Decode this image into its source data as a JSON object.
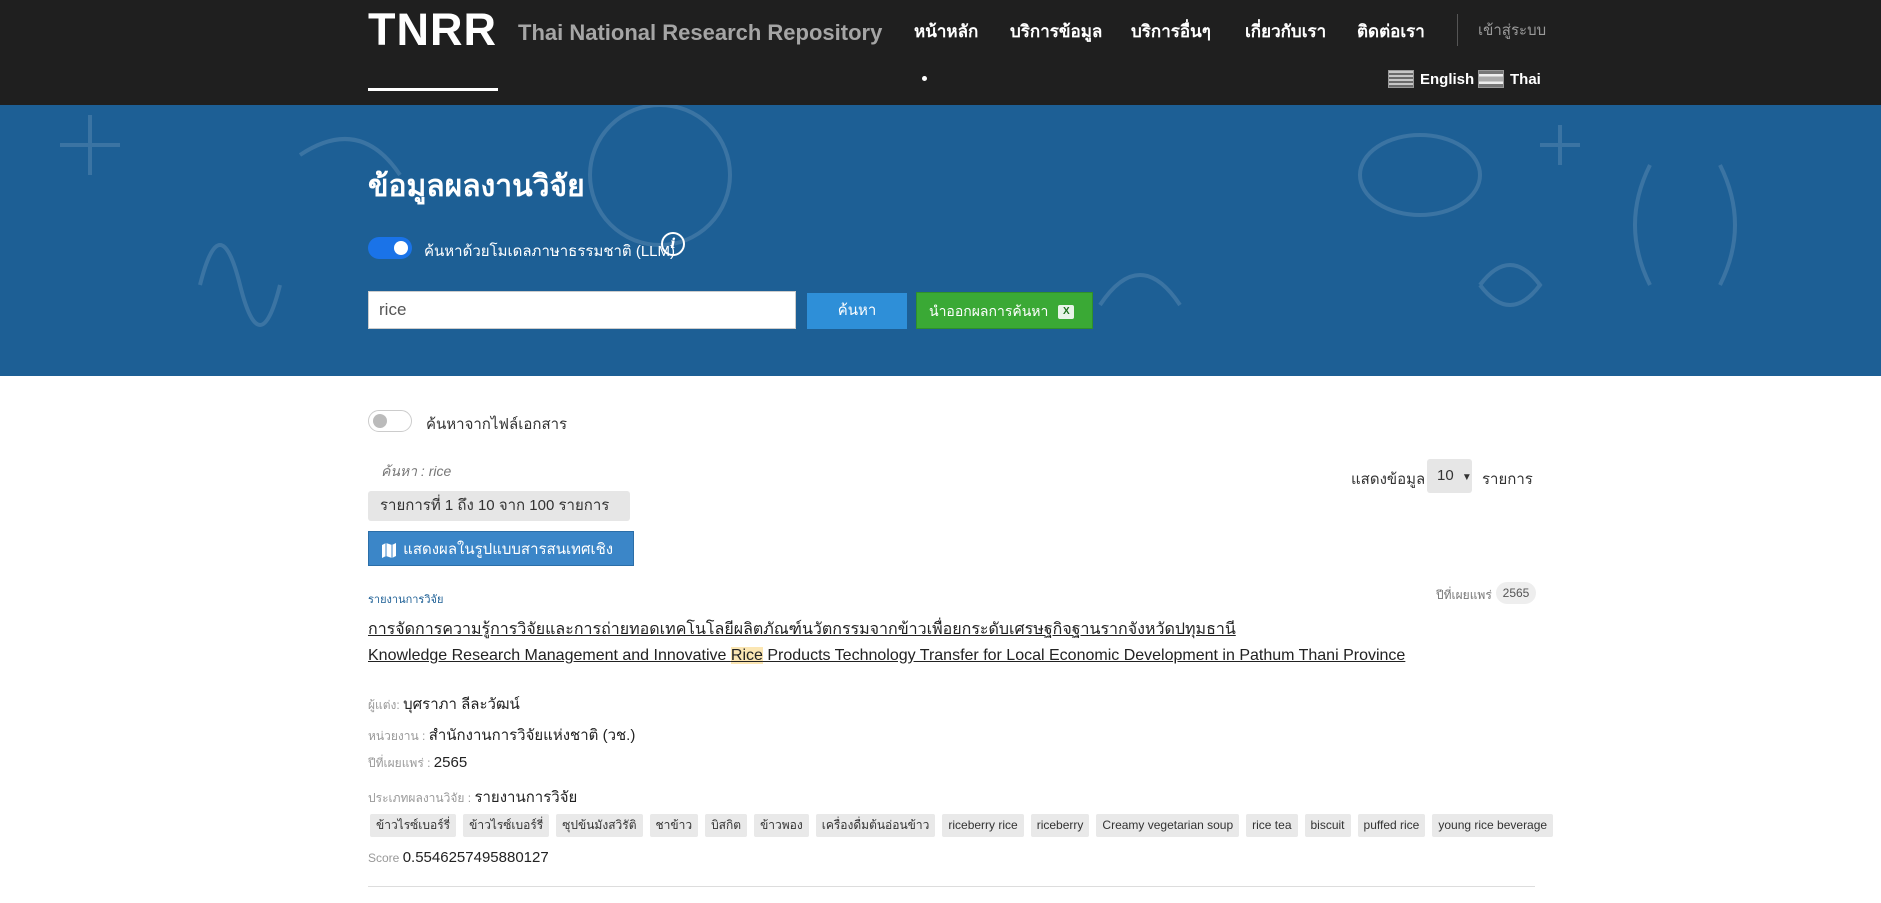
{
  "header": {
    "logo": "TNRR",
    "subtitle": "Thai National Research Repository",
    "nav": [
      "หน้าหลัก",
      "บริการข้อมูล",
      "บริการอื่นๆ",
      "เกี่ยวกับเรา",
      "ติดต่อเรา"
    ],
    "login": "เข้าสู่ระบบ",
    "languages": [
      "English",
      "Thai"
    ]
  },
  "hero": {
    "title": "ข้อมูลผลงานวิจัย",
    "llm_toggle_label": "ค้นหาด้วยโมเดลภาษาธรรมชาติ (LLM)",
    "llm_toggle_on": true,
    "search_value": "rice",
    "search_button": "ค้นหา",
    "export_button": "นำออกผลการค้นหา",
    "info_icon": "info-icon",
    "excel_icon": "excel-icon"
  },
  "filters": {
    "file_search_label": "ค้นหาจากไฟล์เอกสาร",
    "file_search_on": false,
    "query_echo": "ค้นหา : rice",
    "range_text": "รายการที่  1  ถึง  10 จาก  100 รายการ",
    "map_button": "แสดงผลในรูปแบบสารสนเทศเชิงพื้นที่",
    "show_label": "แสดงข้อมูล",
    "page_size": "10",
    "items_label": "รายการ"
  },
  "results": [
    {
      "type": "รายงานการวิจัย",
      "pub_year_label": "ปีที่เผยแพร่",
      "pub_year": "2565",
      "title_th": "การจัดการความรู้การวิจัยและการถ่ายทอดเทคโนโลยีผลิตภัณฑ์นวัตกรรมจากข้าวเพื่อยกระดับเศรษฐกิจฐานรากจังหวัดปทุมธานี",
      "title_en_before": "Knowledge Research Management and Innovative ",
      "title_en_highlight": "Rice",
      "title_en_after": " Products Technology Transfer for Local Economic Development in Pathum Thani Province",
      "author_label": "ผู้แต่ง:",
      "author": "บุศราภา ลีละวัฒน์",
      "agency_label": "หน่วยงาน :",
      "agency": "สำนักงานการวิจัยแห่งชาติ (วช.)",
      "year_label": "ปีที่เผยแพร่ :",
      "year": "2565",
      "category_label": "ประเภทผลงานวิจัย :",
      "category": "รายงานการวิจัย",
      "tags": [
        "ข้าวไรซ์เบอร์รี่",
        "ข้าวไรซ์เบอร์รี่",
        "ซุปข้นมังสวิรัติ",
        "ชาข้าว",
        "บิสกิต",
        "ข้าวพอง",
        "เครื่องดื่มต้นอ่อนข้าว",
        "riceberry rice",
        "riceberry",
        "Creamy vegetarian soup",
        "rice tea",
        "biscuit",
        "puffed rice",
        "young rice beverage"
      ],
      "score_label": "Score",
      "score": "0.5546257495880127"
    }
  ]
}
